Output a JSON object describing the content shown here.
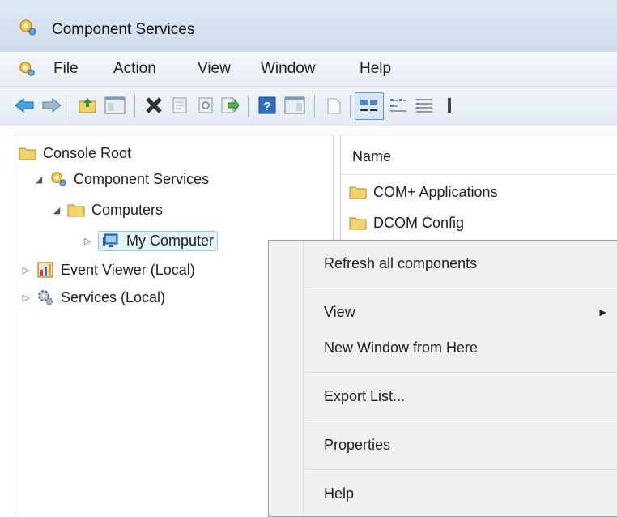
{
  "window": {
    "title": "Component Services"
  },
  "menu": [
    "File",
    "Action",
    "View",
    "Window",
    "Help"
  ],
  "toolbar": {
    "buttons": [
      "back-arrow-icon",
      "forward-arrow-icon",
      "up-folder-icon",
      "show-hide-tree-icon",
      "delete-icon",
      "properties-icon",
      "refresh-icon",
      "export-icon",
      "help-icon",
      "show-hide-action-pane-icon",
      "new-icon",
      "large-icons-view-icon",
      "small-icons-view-icon",
      "list-view-icon"
    ]
  },
  "tree": {
    "root": "Console Root",
    "component_services": "Component Services",
    "computers": "Computers",
    "my_computer": "My Computer",
    "event_viewer": "Event Viewer (Local)",
    "services": "Services (Local)"
  },
  "list": {
    "column_name": "Name",
    "items": [
      "COM+ Applications",
      "DCOM Config"
    ]
  },
  "context_menu": {
    "refresh": "Refresh all components",
    "view": "View",
    "new_window": "New Window from Here",
    "export": "Export List...",
    "properties": "Properties",
    "help": "Help"
  },
  "colors": {
    "selection_bg": "#e5f3fb",
    "selection_border": "#98c6e6",
    "folder": "#f2d36b"
  }
}
